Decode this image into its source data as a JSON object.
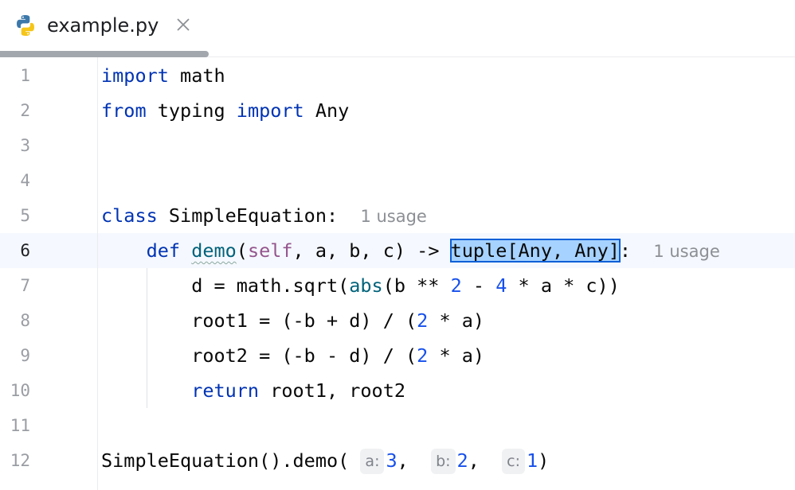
{
  "tab": {
    "title": "example.py",
    "icon": "python-file-icon",
    "close_icon": "close-icon"
  },
  "editor": {
    "current_line": 6,
    "lines": [
      {
        "n": "1"
      },
      {
        "n": "2"
      },
      {
        "n": "3"
      },
      {
        "n": "4"
      },
      {
        "n": "5"
      },
      {
        "n": "6"
      },
      {
        "n": "7"
      },
      {
        "n": "8"
      },
      {
        "n": "9"
      },
      {
        "n": "10"
      },
      {
        "n": "11"
      },
      {
        "n": "12"
      }
    ],
    "tokens": {
      "import": "import",
      "math": "math",
      "from": "from",
      "typing": "typing",
      "Any": "Any",
      "class": "class",
      "SimpleEquation": "SimpleEquation",
      "colon": ":",
      "def": "def",
      "demo": "demo",
      "self": "self",
      "params_tail": ", a, b, c) ->",
      "selected_type": "tuple[Any, Any]",
      "line7_a": "d = math.sqrt(",
      "abs": "abs",
      "line7_b": "(b ** ",
      "two": "2",
      "minus": " - ",
      "four": "4",
      "line7_c": " * a * c))",
      "line8_a": "root1 = (-b + d) / (",
      "line8_b": " * a)",
      "line9_a": "root2 = (-b - d) / (",
      "line9_b": " * a)",
      "return": "return",
      "return_vals": " root1, root2",
      "call": "SimpleEquation().demo(",
      "arg_a": "3",
      "arg_b": "2",
      "arg_c": "1",
      "comma": ",",
      "close_paren": ")"
    },
    "hints": {
      "class_usage": "1 usage",
      "def_usage": "1 usage",
      "param_a": "a:",
      "param_b": "b:",
      "param_c": "c:"
    }
  },
  "colors": {
    "keyword": "#0033b3",
    "function": "#00627a",
    "self": "#94558d",
    "number": "#1750eb",
    "selection": "#a6d2ff"
  }
}
